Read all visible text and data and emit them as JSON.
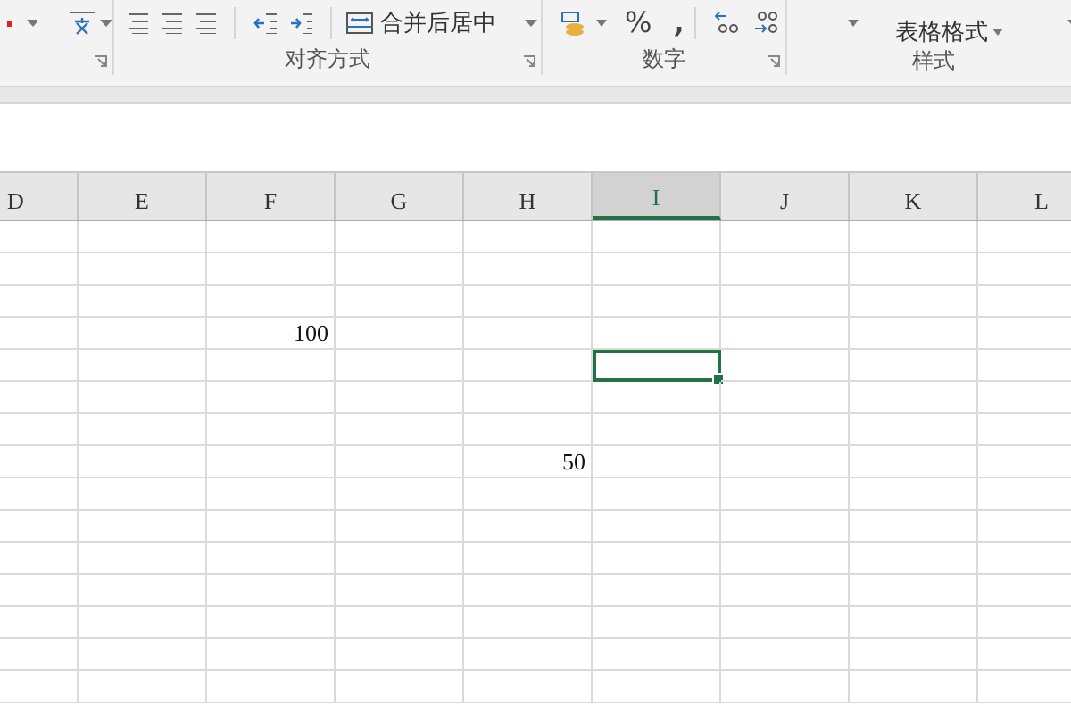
{
  "ribbon": {
    "groups": [
      {
        "label": "对齐方式"
      },
      {
        "label": "数字"
      },
      {
        "label": "样式"
      }
    ],
    "merge_button": "合并后居中",
    "percent": "%",
    "comma": ",",
    "table_format": "表格格式"
  },
  "sheet": {
    "columns": [
      {
        "label": "D",
        "selected": false
      },
      {
        "label": "E",
        "selected": false
      },
      {
        "label": "F",
        "selected": false
      },
      {
        "label": "G",
        "selected": false
      },
      {
        "label": "H",
        "selected": false
      },
      {
        "label": "I",
        "selected": true
      },
      {
        "label": "J",
        "selected": false
      },
      {
        "label": "K",
        "selected": false
      },
      {
        "label": "L",
        "selected": false
      }
    ],
    "rows": [
      {
        "cells": [
          {
            "selected": false
          },
          {
            "selected": false
          },
          {
            "selected": false
          },
          {
            "selected": false
          },
          {
            "selected": false
          },
          {
            "selected": false
          },
          {
            "selected": false
          },
          {
            "selected": false
          },
          {
            "selected": false
          }
        ]
      },
      {
        "cells": [
          {
            "selected": false
          },
          {
            "selected": false
          },
          {
            "selected": false
          },
          {
            "selected": false
          },
          {
            "selected": false
          },
          {
            "selected": false
          },
          {
            "selected": false
          },
          {
            "selected": false
          },
          {
            "selected": false
          }
        ]
      },
      {
        "cells": [
          {
            "selected": false
          },
          {
            "selected": false
          },
          {
            "selected": false
          },
          {
            "selected": false
          },
          {
            "selected": false
          },
          {
            "selected": false
          },
          {
            "selected": false
          },
          {
            "selected": false
          },
          {
            "selected": false
          }
        ]
      },
      {
        "cells": [
          {
            "selected": false
          },
          {
            "selected": false
          },
          {
            "selected": false,
            "value": "100"
          },
          {
            "selected": false
          },
          {
            "selected": false
          },
          {
            "selected": false
          },
          {
            "selected": false
          },
          {
            "selected": false
          },
          {
            "selected": false
          }
        ]
      },
      {
        "cells": [
          {
            "selected": false
          },
          {
            "selected": false
          },
          {
            "selected": false
          },
          {
            "selected": false
          },
          {
            "selected": false
          },
          {
            "selected": true
          },
          {
            "selected": false
          },
          {
            "selected": false
          },
          {
            "selected": false
          }
        ]
      },
      {
        "cells": [
          {
            "selected": false
          },
          {
            "selected": false
          },
          {
            "selected": false
          },
          {
            "selected": false
          },
          {
            "selected": false
          },
          {
            "selected": false
          },
          {
            "selected": false
          },
          {
            "selected": false
          },
          {
            "selected": false
          }
        ]
      },
      {
        "cells": [
          {
            "selected": false
          },
          {
            "selected": false
          },
          {
            "selected": false
          },
          {
            "selected": false
          },
          {
            "selected": false
          },
          {
            "selected": false
          },
          {
            "selected": false
          },
          {
            "selected": false
          },
          {
            "selected": false
          }
        ]
      },
      {
        "cells": [
          {
            "selected": false
          },
          {
            "selected": false
          },
          {
            "selected": false
          },
          {
            "selected": false
          },
          {
            "selected": false,
            "value": "50"
          },
          {
            "selected": false
          },
          {
            "selected": false
          },
          {
            "selected": false
          },
          {
            "selected": false
          }
        ]
      },
      {
        "cells": [
          {
            "selected": false
          },
          {
            "selected": false
          },
          {
            "selected": false
          },
          {
            "selected": false
          },
          {
            "selected": false
          },
          {
            "selected": false
          },
          {
            "selected": false
          },
          {
            "selected": false
          },
          {
            "selected": false
          }
        ]
      },
      {
        "cells": [
          {
            "selected": false
          },
          {
            "selected": false
          },
          {
            "selected": false
          },
          {
            "selected": false
          },
          {
            "selected": false
          },
          {
            "selected": false
          },
          {
            "selected": false
          },
          {
            "selected": false
          },
          {
            "selected": false
          }
        ]
      },
      {
        "cells": [
          {
            "selected": false
          },
          {
            "selected": false
          },
          {
            "selected": false
          },
          {
            "selected": false
          },
          {
            "selected": false
          },
          {
            "selected": false
          },
          {
            "selected": false
          },
          {
            "selected": false
          },
          {
            "selected": false
          }
        ]
      },
      {
        "cells": [
          {
            "selected": false
          },
          {
            "selected": false
          },
          {
            "selected": false
          },
          {
            "selected": false
          },
          {
            "selected": false
          },
          {
            "selected": false
          },
          {
            "selected": false
          },
          {
            "selected": false
          },
          {
            "selected": false
          }
        ]
      },
      {
        "cells": [
          {
            "selected": false
          },
          {
            "selected": false
          },
          {
            "selected": false
          },
          {
            "selected": false
          },
          {
            "selected": false
          },
          {
            "selected": false
          },
          {
            "selected": false
          },
          {
            "selected": false
          },
          {
            "selected": false
          }
        ]
      },
      {
        "cells": [
          {
            "selected": false
          },
          {
            "selected": false
          },
          {
            "selected": false
          },
          {
            "selected": false
          },
          {
            "selected": false
          },
          {
            "selected": false
          },
          {
            "selected": false
          },
          {
            "selected": false
          },
          {
            "selected": false
          }
        ]
      },
      {
        "cells": [
          {
            "selected": false
          },
          {
            "selected": false
          },
          {
            "selected": false
          },
          {
            "selected": false
          },
          {
            "selected": false
          },
          {
            "selected": false
          },
          {
            "selected": false
          },
          {
            "selected": false
          },
          {
            "selected": false
          }
        ]
      }
    ]
  }
}
